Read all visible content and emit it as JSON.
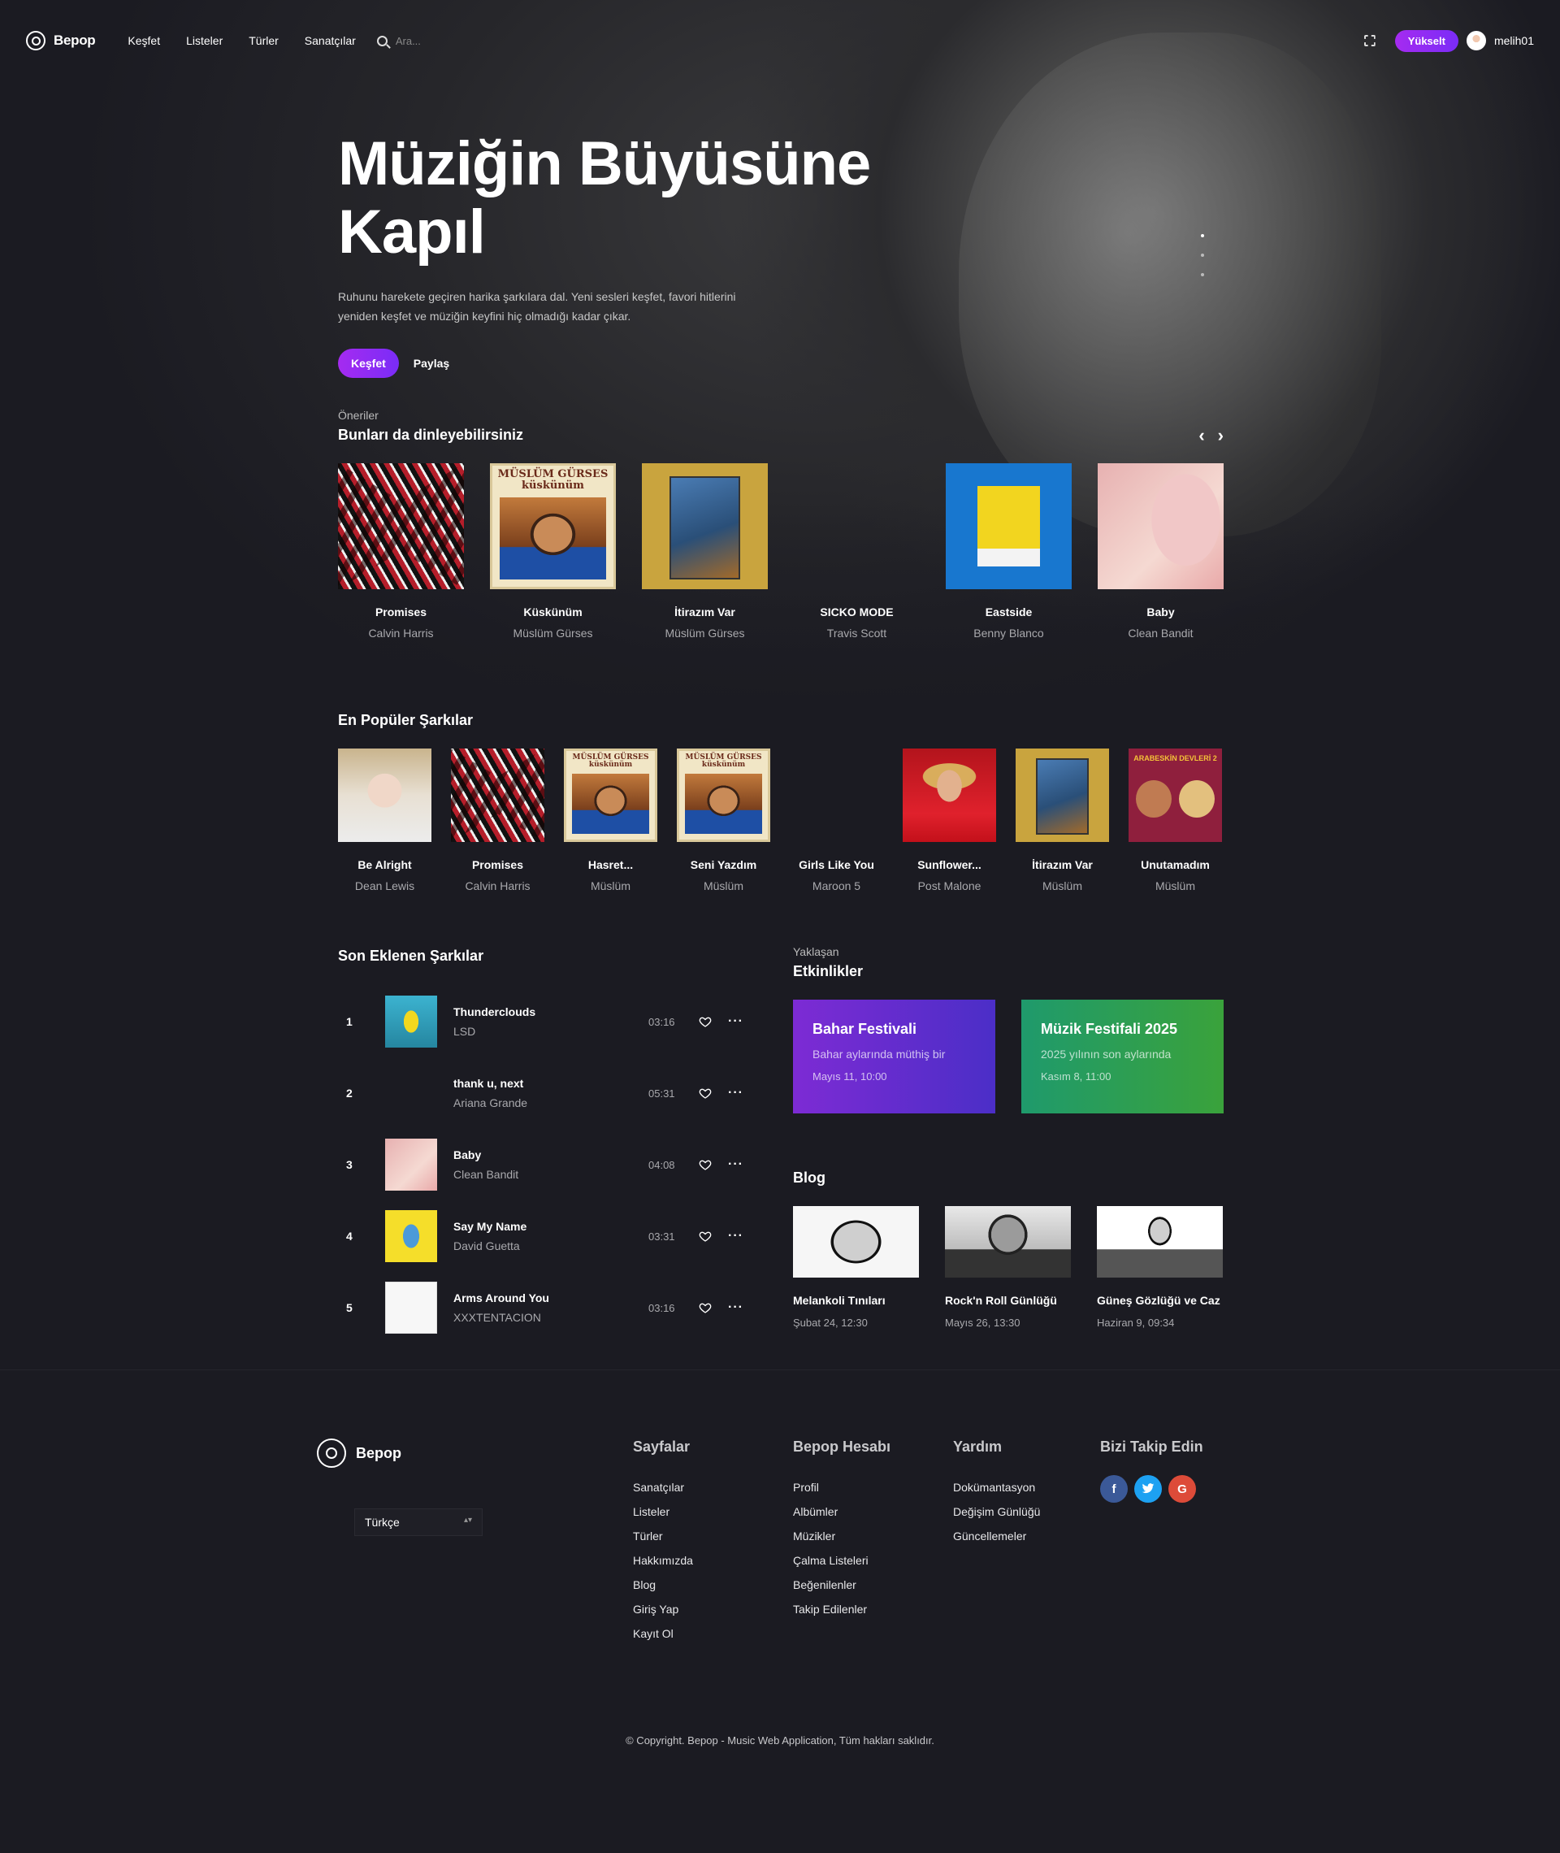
{
  "brand": "Bepop",
  "nav": [
    "Keşfet",
    "Listeler",
    "Türler",
    "Sanatçılar"
  ],
  "search": {
    "placeholder": "Ara..."
  },
  "topbar": {
    "upgrade_label": "Yükselt",
    "username": "melih01"
  },
  "hero": {
    "title": "Müziğin Büyüsüne Kapıl",
    "description": "Ruhunu harekete geçiren harika şarkılara dal. Yeni sesleri keşfet, favori hitlerini yeniden keşfet ve müziğin keyfini hiç olmadığı kadar çıkar.",
    "primary_label": "Keşfet",
    "secondary_label": "Paylaş"
  },
  "recommendations": {
    "eyebrow": "Öneriler",
    "title": "Bunları da dinleyebilirsiniz",
    "prev": "‹",
    "next": "›",
    "items": [
      {
        "title": "Promises",
        "artist": "Calvin Harris"
      },
      {
        "title": "Küskünüm",
        "artist": "Müslüm Gürses",
        "cover_text": "MÜSLÜM GÜRSES küskünüm"
      },
      {
        "title": "İtirazım Var",
        "artist": "Müslüm Gürses"
      },
      {
        "title": "SICKO MODE",
        "artist": "Travis Scott"
      },
      {
        "title": "Eastside",
        "artist": "Benny Blanco"
      },
      {
        "title": "Baby",
        "artist": "Clean Bandit"
      }
    ]
  },
  "popular": {
    "title": "En Popüler Şarkılar",
    "items": [
      {
        "title": "Be Alright",
        "artist": "Dean Lewis"
      },
      {
        "title": "Promises",
        "artist": "Calvin Harris"
      },
      {
        "title": "Hasret...",
        "artist": "Müslüm",
        "cover_text": "MÜSLÜM GÜRSES küskünüm"
      },
      {
        "title": "Seni Yazdım",
        "artist": "Müslüm",
        "cover_text": "MÜSLÜM GÜRSES küskünüm"
      },
      {
        "title": "Girls Like You",
        "artist": "Maroon 5"
      },
      {
        "title": "Sunflower...",
        "artist": "Post Malone"
      },
      {
        "title": "İtirazım Var",
        "artist": "Müslüm"
      },
      {
        "title": "Unutamadım",
        "artist": "Müslüm",
        "cover_text": "ARABESKİN DEVLERİ 2"
      }
    ]
  },
  "recent": {
    "title": "Son Eklenen Şarkılar",
    "items": [
      {
        "index": "1",
        "title": "Thunderclouds",
        "artist": "LSD",
        "duration": "03:16"
      },
      {
        "index": "2",
        "title": "thank u, next",
        "artist": "Ariana Grande",
        "duration": "05:31"
      },
      {
        "index": "3",
        "title": "Baby",
        "artist": "Clean Bandit",
        "duration": "04:08"
      },
      {
        "index": "4",
        "title": "Say My Name",
        "artist": "David Guetta",
        "duration": "03:31"
      },
      {
        "index": "5",
        "title": "Arms Around You",
        "artist": "XXXTENTACION",
        "duration": "03:16"
      }
    ]
  },
  "events": {
    "eyebrow": "Yaklaşan",
    "title": "Etkinlikler",
    "items": [
      {
        "title": "Bahar Festivali",
        "description": "Bahar aylarında müthiş bir",
        "date": "Mayıs 11, 10:00",
        "color": "#7d2bd4"
      },
      {
        "title": "Müzik Festifali 2025",
        "description": "2025 yılının son aylarında",
        "date": "Kasım 8, 11:00",
        "color": "#2a9e54"
      }
    ]
  },
  "blog": {
    "title": "Blog",
    "items": [
      {
        "title": "Melankoli Tınıları",
        "date": "Şubat 24, 12:30"
      },
      {
        "title": "Rock'n Roll Günlüğü",
        "date": "Mayıs 26, 13:30"
      },
      {
        "title": "Güneş Gözlüğü ve Caz",
        "date": "Haziran 9, 09:34"
      }
    ]
  },
  "footer": {
    "brand": "Bepop",
    "language": "Türkçe",
    "columns": [
      {
        "title": "Sayfalar",
        "links": [
          "Sanatçılar",
          "Listeler",
          "Türler",
          "Hakkımızda",
          "Blog",
          "Giriş Yap",
          "Kayıt Ol"
        ]
      },
      {
        "title": "Bepop Hesabı",
        "links": [
          "Profil",
          "Albümler",
          "Müzikler",
          "Çalma Listeleri",
          "Beğenilenler",
          "Takip Edilenler"
        ]
      },
      {
        "title": "Yardım",
        "links": [
          "Dokümantasyon",
          "Değişim Günlüğü",
          "Güncellemeler"
        ]
      }
    ],
    "social_title": "Bizi Takip Edin",
    "social": {
      "facebook": "f",
      "twitter": "t",
      "google": "G"
    },
    "copyright": "© Copyright. Bepop - Music Web Application, Tüm hakları saklıdır."
  },
  "colors": {
    "accent": "#9b2cf3",
    "background": "#1b1b22"
  }
}
